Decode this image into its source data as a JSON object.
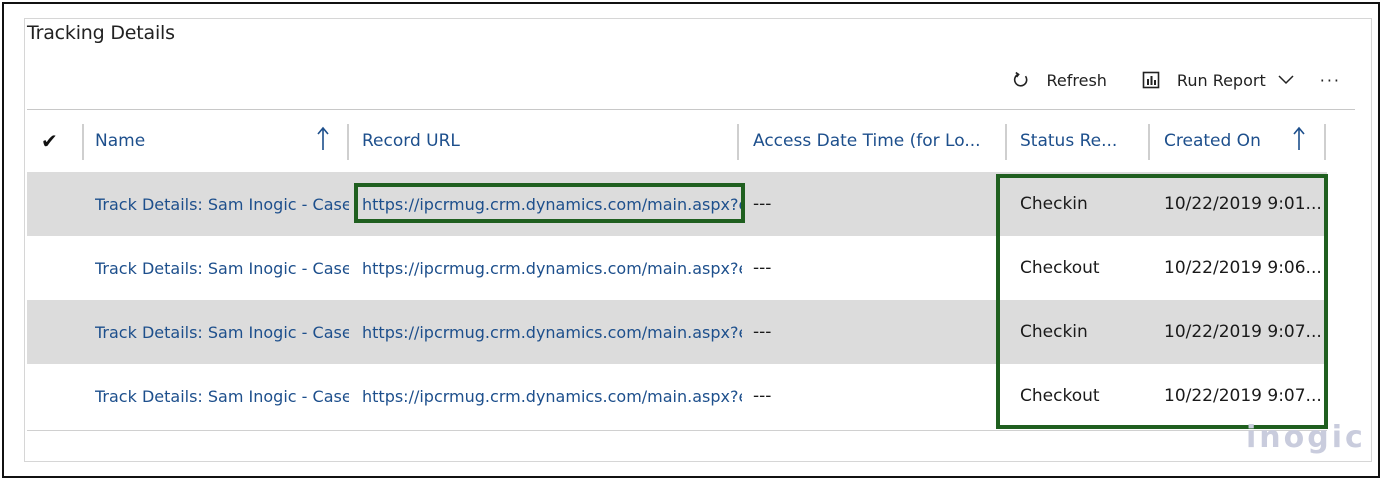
{
  "panel": {
    "title": "Tracking Details"
  },
  "toolbar": {
    "refresh_label": "Refresh",
    "run_report_label": "Run Report",
    "more_label": "···"
  },
  "columns": {
    "check": "✔",
    "name": "Name",
    "record_url": "Record URL",
    "access_date_time": "Access Date Time (for Lo...",
    "status": "Status Re...",
    "created_on": "Created On"
  },
  "rows": [
    {
      "name": "Track Details: Sam Inogic - Case -",
      "url": "https://ipcrmug.crm.dynamics.com/main.aspx?etn",
      "access": "---",
      "status": "Checkin",
      "created": "10/22/2019 9:01..."
    },
    {
      "name": "Track Details: Sam Inogic - Case -",
      "url": "https://ipcrmug.crm.dynamics.com/main.aspx?etn",
      "access": "---",
      "status": "Checkout",
      "created": "10/22/2019 9:06..."
    },
    {
      "name": "Track Details: Sam Inogic - Case -",
      "url": "https://ipcrmug.crm.dynamics.com/main.aspx?etn",
      "access": "---",
      "status": "Checkin",
      "created": "10/22/2019 9:07..."
    },
    {
      "name": "Track Details: Sam Inogic - Case -",
      "url": "https://ipcrmug.crm.dynamics.com/main.aspx?etn",
      "access": "---",
      "status": "Checkout",
      "created": "10/22/2019 9:07..."
    }
  ],
  "watermark": "inogic",
  "colors": {
    "link": "#1d4f8c",
    "highlight": "#1f5f1f",
    "alt_row": "#dcdcdc"
  }
}
